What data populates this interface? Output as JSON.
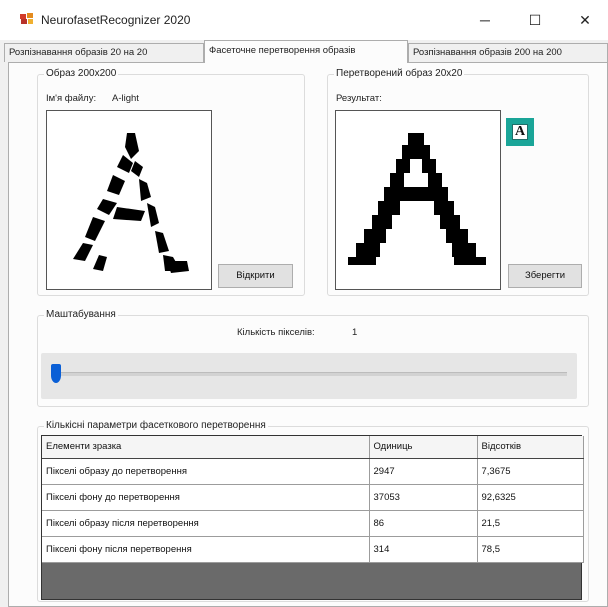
{
  "window": {
    "title": "NeurofasetRecognizer 2020",
    "minimize_glyph": "─",
    "maximize_glyph": "☐",
    "close_glyph": "✕"
  },
  "tabs": [
    {
      "label": "Розпізнавання образів 20 на 20",
      "active": false
    },
    {
      "label": "Фасеточне перетворення образів",
      "active": true
    },
    {
      "label": "Розпізнавання образів 200 на 200",
      "active": false
    }
  ],
  "source_group": {
    "title": "Образ 200х200",
    "filename_label": "Ім'я файлу:",
    "filename_value": "A-light",
    "open_button": "Відкрити"
  },
  "result_group": {
    "title": "Перетворений образ  20х20",
    "result_label": "Результат:",
    "save_button": "Зберегти",
    "preview_letter": "A",
    "preview_color": "#1aa598"
  },
  "scale_group": {
    "title": "Маштабування",
    "pixel_count_label": "Кількість пікселів:",
    "pixel_count_value": "1",
    "slider_value": 1
  },
  "params_group": {
    "title": "Кількісні параметри фасеткового перетворення",
    "columns": [
      "Елементи зразка",
      "Одиниць",
      "Відсотків"
    ],
    "rows": [
      [
        "Пікселі образу до перетворення",
        "2947",
        "7,3675"
      ],
      [
        "Пікселі фону до перетворення",
        "37053",
        "92,6325"
      ],
      [
        "Пікселі образу після перетворення",
        "86",
        "21,5"
      ],
      [
        "Пікселі фону після перетворення",
        "314",
        "78,5"
      ]
    ]
  },
  "icons": {
    "app": "app-icon"
  }
}
